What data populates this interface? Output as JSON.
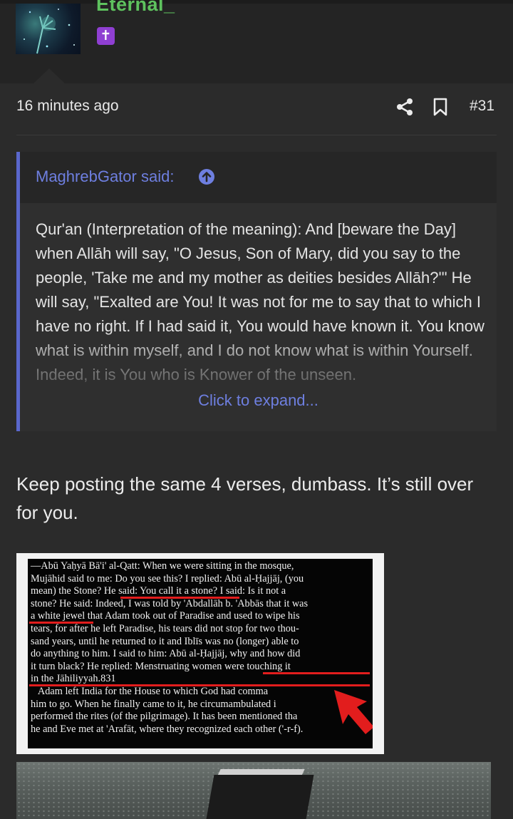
{
  "user": {
    "name": "Eternal_",
    "badge_glyph": "✝",
    "colors": {
      "name": "#5ec25e",
      "badge": "#8f3fd2"
    }
  },
  "post": {
    "timestamp": "16 minutes ago",
    "number": "#31",
    "icons": [
      "share-icon",
      "bookmark-icon"
    ],
    "quote": {
      "author_line": "MaghrebGator said:",
      "body": "Qur'an (Interpretation of the meaning): And [beware the Day] when Allāh will say, \"O Jesus, Son of Mary, did you say to the people, 'Take me and my mother as deities besides Allāh?'\" He will say, \"Exalted are You! It was not for me to say that to which I have no right. If I had said it, You would have known it. You know what is within myself, and I do not know what is within Yourself. Indeed, it is You who is Knower of the unseen.",
      "expand_label": "Click to expand...",
      "accent": "#5a67cc"
    },
    "reply": "Keep posting the same 4 verses, dumbass. It’s still over for you.",
    "scan_text": "—Abū Yaḥyā Bā'i' al-Qatt: When we were sitting in the mosque,\nMujāhid said to me: Do you see this? I replied: Abū al-Ḥajjāj, (you\nmean) the Stone? He said: You call it a stone? I said: Is it not a\nstone? He said: Indeed, I was told by 'Abdallāh b. 'Abbās that it was\na white jewel that Adam took out of Paradise and used to wipe his\ntears, for after he left Paradise, his tears did not stop for two thou-\nsand years, until he returned to it and Iblīs was no (longer) able to\ndo anything to him. I said to him: Abū al-Ḥajjāj, why and how did\nit turn black? He replied: Menstruating women were touching it\nin the Jāhiliyyah.831\n   Adam left India for the House to which God had comma\nhim to go. When he finally came to it, he circumambulated i\nperformed the rites (of the pilgrimage). It has been mentioned tha\nhe and Eve met at 'Arafāt, where they recognized each other ('-r-f)."
  }
}
